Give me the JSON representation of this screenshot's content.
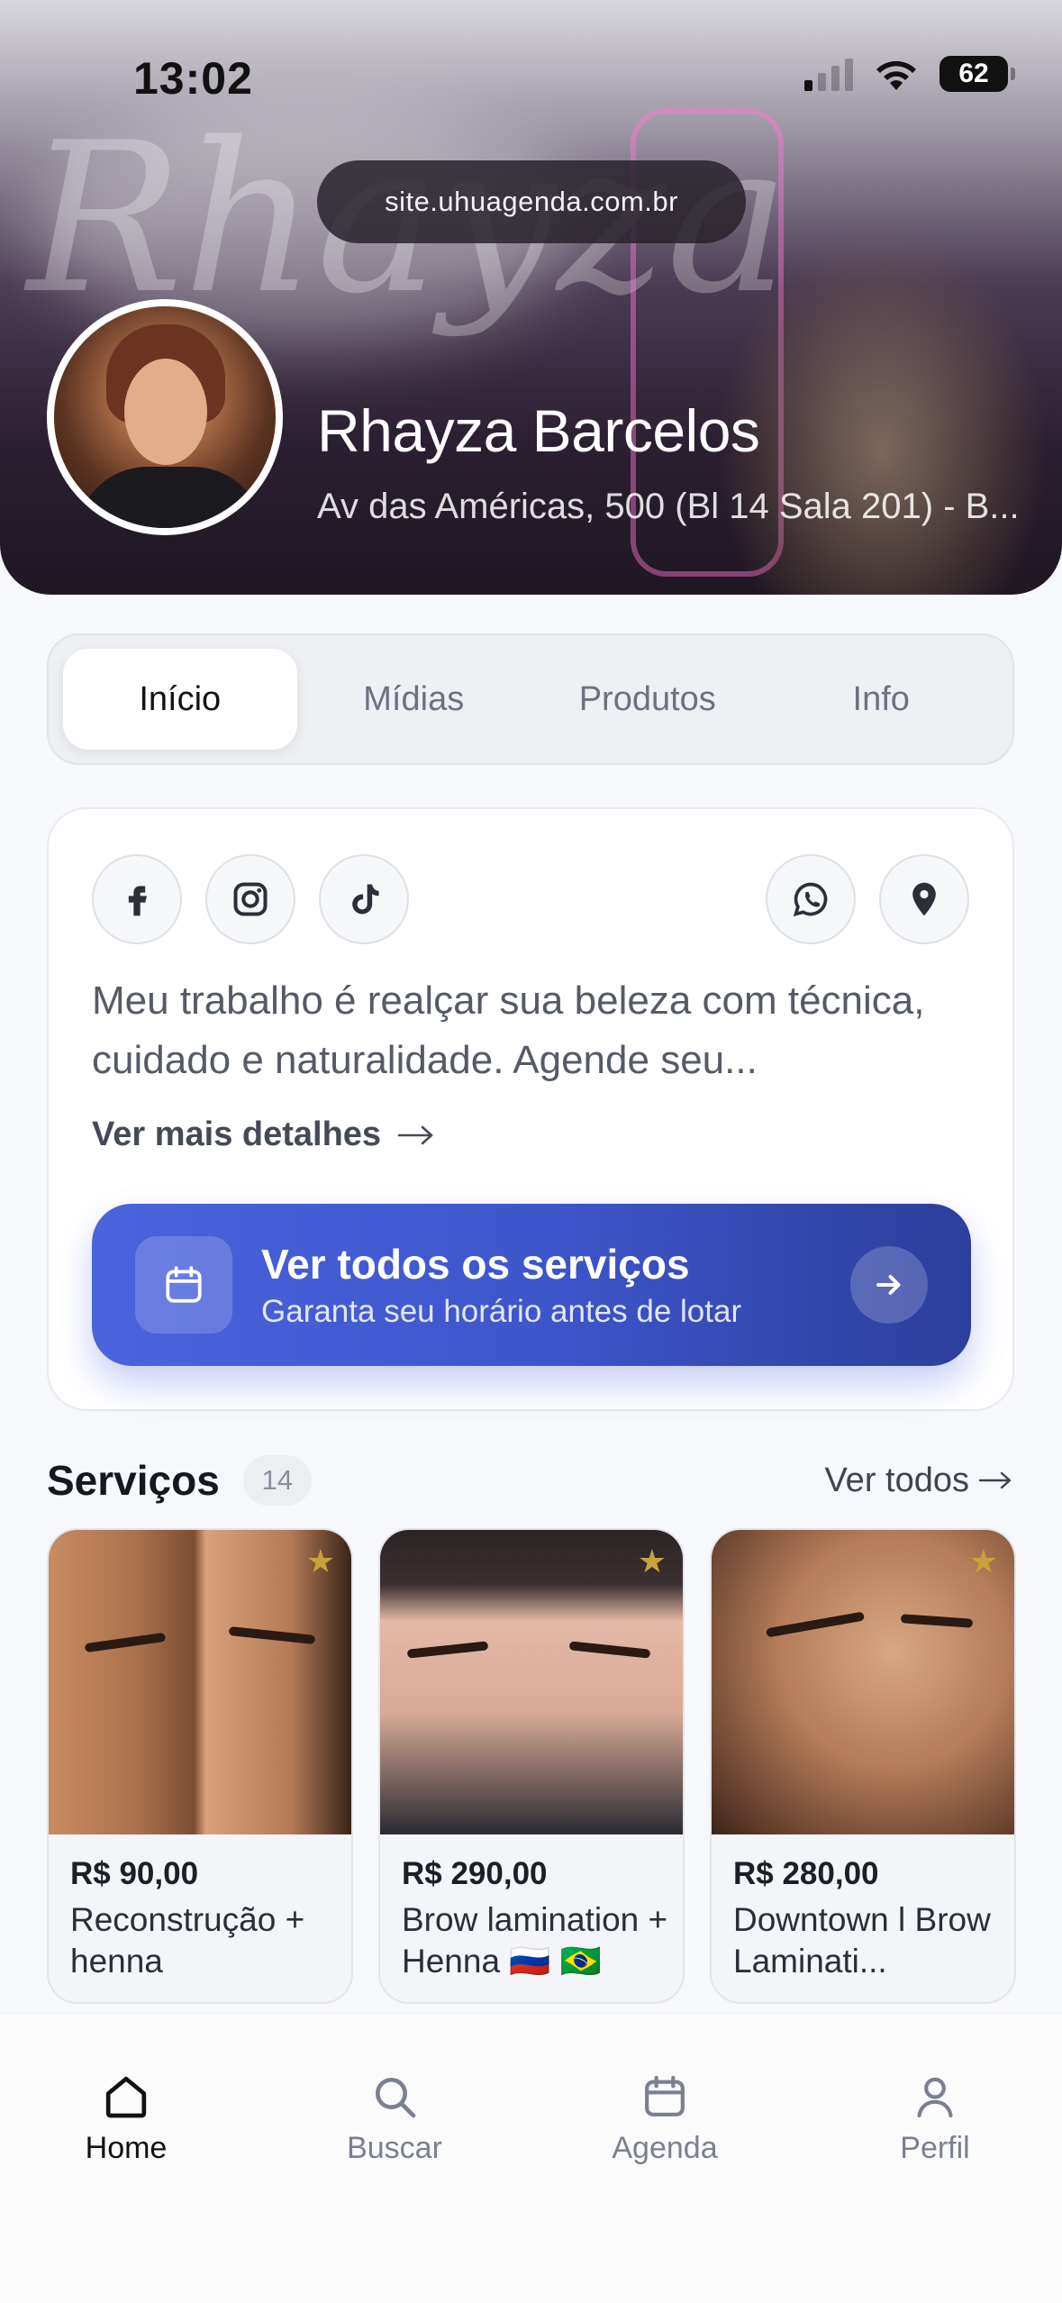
{
  "status_bar": {
    "time": "13:02",
    "battery": "62"
  },
  "header": {
    "url": "site.uhuagenda.com.br",
    "name": "Rhayza Barcelos",
    "address": "Av das Américas, 500 (Bl 14 Sala 201) - B..."
  },
  "tabs": [
    {
      "label": "Início",
      "active": true
    },
    {
      "label": "Mídias",
      "active": false
    },
    {
      "label": "Produtos",
      "active": false
    },
    {
      "label": "Info",
      "active": false
    }
  ],
  "about": {
    "social_icons": [
      "facebook-icon",
      "instagram-icon",
      "tiktok-icon"
    ],
    "contact_icons": [
      "whatsapp-icon",
      "location-pin-icon"
    ],
    "bio": "Meu trabalho é realçar sua beleza com técnica, cuidado e naturalidade. Agende seu...",
    "more_link": "Ver mais detalhes",
    "cta_title": "Ver todos os serviços",
    "cta_subtitle": "Garanta seu horário antes de lotar"
  },
  "services": {
    "title": "Serviços",
    "count": "14",
    "see_all": "Ver todos",
    "items": [
      {
        "price": "R$ 90,00",
        "name": "Reconstrução + henna"
      },
      {
        "price": "R$ 290,00",
        "name": "Brow lamination + Henna 🇷🇺 🇧🇷"
      },
      {
        "price": "R$ 280,00",
        "name": "Downtown l Brow Laminati..."
      }
    ]
  },
  "bottom_nav": [
    {
      "label": "Home",
      "icon": "home-icon",
      "active": true
    },
    {
      "label": "Buscar",
      "icon": "search-icon",
      "active": false
    },
    {
      "label": "Agenda",
      "icon": "calendar-icon",
      "active": false
    },
    {
      "label": "Perfil",
      "icon": "user-icon",
      "active": false
    }
  ],
  "colors": {
    "accent": "#3d56cc",
    "star": "#c8a23c"
  }
}
